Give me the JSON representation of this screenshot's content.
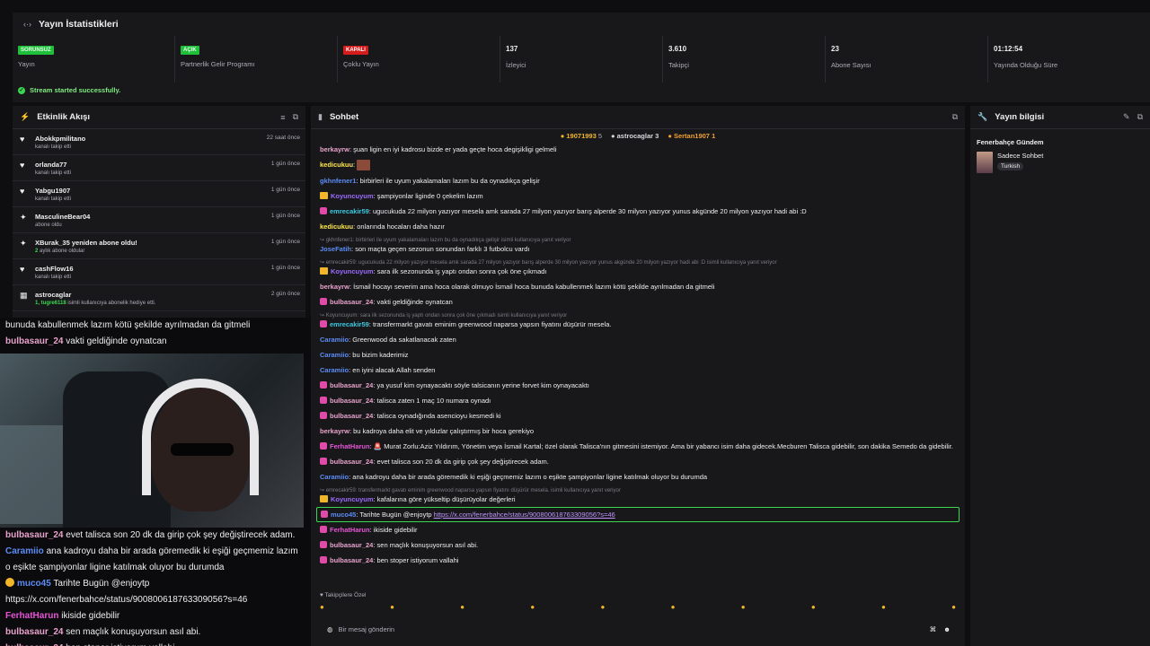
{
  "stats_panel": {
    "title": "Yayın İstatistikleri",
    "items": [
      {
        "badge": "SORUNSUZ",
        "badge_color": "green",
        "label": "Yayın"
      },
      {
        "badge": "AÇIK",
        "badge_color": "green",
        "label": "Partnerlik Gelir Programı"
      },
      {
        "badge": "KAPALI",
        "badge_color": "red",
        "label": "Çoklu Yayın"
      },
      {
        "value": "137",
        "label": "İzleyici"
      },
      {
        "value": "3.610",
        "label": "Takipçi"
      },
      {
        "value": "23",
        "label": "Abone Sayısı"
      },
      {
        "value": "01:12:54",
        "label": "Yayında Olduğu Süre"
      }
    ],
    "success_message": "Stream started successfully."
  },
  "activity": {
    "title": "Etkinlik Akışı",
    "items": [
      {
        "icon": "heart-icon",
        "glyph": "♥",
        "name": "Abokkpmilitano",
        "sub": "kanalı takip etti",
        "time": "22 saat önce"
      },
      {
        "icon": "heart-icon",
        "glyph": "♥",
        "name": "orlanda77",
        "sub": "kanalı takip etti",
        "time": "1 gün önce"
      },
      {
        "icon": "heart-icon",
        "glyph": "♥",
        "name": "Yabgu1907",
        "sub": "kanalı takip etti",
        "time": "1 gün önce"
      },
      {
        "icon": "star-icon",
        "glyph": "✦",
        "name": "MasculineBear04",
        "sub": "abone oldu",
        "time": "1 gün önce"
      },
      {
        "icon": "star-icon",
        "glyph": "✦",
        "name": "XBurak_35 yeniden abone oldu!",
        "sub_hl": "2",
        "sub": " aylık abone oldular",
        "time": "1 gün önce"
      },
      {
        "icon": "heart-icon",
        "glyph": "♥",
        "name": "cashFlow16",
        "sub": "kanalı takip etti",
        "time": "1 gün önce"
      },
      {
        "icon": "gift-icon",
        "glyph": "▦",
        "name": "astrocaglar",
        "sub_hl": "1, tugre6118",
        "sub": " isimli kullanıcıya abonelik hediye etti.",
        "time": "2 gün önce"
      }
    ]
  },
  "chat": {
    "title": "Sohbet",
    "pinned": [
      {
        "name": "19071993",
        "count": "5"
      },
      {
        "name": "astrocaglar",
        "count": "3"
      },
      {
        "name": "Sertan1907",
        "count": "1"
      }
    ],
    "messages": [
      {
        "user": "berkayrw",
        "color": "c-pink",
        "badge": "",
        "text": "şuan ligin en iyi kadrosu bizde er yada geçte hoca degişikligi gelmeli"
      },
      {
        "user": "kedicukuu",
        "color": "c-yellow",
        "badge": "",
        "text": "",
        "emote": true
      },
      {
        "user": "gkhnfener1",
        "color": "c-blue",
        "badge": "",
        "text": "birbirleri ile uyum yakalamaları lazım bu da oynadıkça gelişir"
      },
      {
        "user": "Koyuncuyum",
        "color": "c-purple",
        "badge": "crown",
        "text": "şampiyonlar liginde 0 çekelim lazım"
      },
      {
        "user": "emrecakir59",
        "color": "c-cyan",
        "badge": "sub",
        "text": "ugucukuda 22 milyon yazıyor mesela amk sarada 27 milyon yazıyor barış alperde 30 milyon yazıyor yunus akgünde 20 milyon yazıyor hadi abi :D"
      },
      {
        "user": "kedicukuu",
        "color": "c-yellow",
        "badge": "",
        "text": "onlarında hocaları daha hazır"
      },
      {
        "reply": "↪ gkhnfener1: birbirleri ile uyum yakalamaları lazım bu da oynadıkça gelişir isimli kullanıcıya yanıt veriyor",
        "user": "JoseFatih",
        "color": "c-blue",
        "badge": "",
        "text": "son maçta geçen sezonun sonundan farklı 3 futbolcu vardı"
      },
      {
        "reply": "↪ emrecakir59: ugucukuda 22 milyon yazıyor mesela amk sarada 27 milyon yazıyor barış alperde 30 milyon yazıyor yunus akgünde 20 milyon yazıyor hadi abi :D isimli kullanıcıya yanıt veriyor",
        "user": "Koyuncuyum",
        "color": "c-purple",
        "badge": "crown",
        "text": "sara ilk sezonunda iş yaptı ondan sonra çok öne çıkmadı"
      },
      {
        "user": "berkayrw",
        "color": "c-pink",
        "badge": "",
        "text": "İsmail hocayı severim ama hoca olarak olmuyo İsmail hoca bunuda kabullenmek lazım kötü şekilde ayrılmadan da gitmeli"
      },
      {
        "user": "bulbasaur_24",
        "color": "c-pink",
        "badge": "sub",
        "text": "vakti geldiğinde oynatcan"
      },
      {
        "reply": "↪ Koyuncuyum: sara ilk sezonunda iş yaptı ondan sonra çok öne çıkmadı isimli kullanıcıya yanıt veriyor",
        "user": "emrecakir59",
        "color": "c-cyan",
        "badge": "sub",
        "text": "transfermarkt gavatı eminim greenwood naparsa yapsın fiyatını düşürür mesela."
      },
      {
        "user": "Caramiio",
        "color": "c-blue",
        "badge": "",
        "text": "Greenwood da sakatlanacak zaten"
      },
      {
        "user": "Caramiio",
        "color": "c-blue",
        "badge": "",
        "text": "bu bizim kaderimiz"
      },
      {
        "user": "Caramiio",
        "color": "c-blue",
        "badge": "",
        "text": "en iyini alacak Allah senden"
      },
      {
        "user": "bulbasaur_24",
        "color": "c-pink",
        "badge": "sub",
        "text": "ya yusuf kim oynayacaktı söyle talsicanın yerine forvet kim oynayacaktı"
      },
      {
        "user": "bulbasaur_24",
        "color": "c-pink",
        "badge": "sub",
        "text": "talisca zaten 1 maç 10 numara oynadı"
      },
      {
        "user": "bulbasaur_24",
        "color": "c-pink",
        "badge": "sub",
        "text": "talisca oynadığında asencioyu kesmedi ki"
      },
      {
        "user": "berkayrw",
        "color": "c-pink",
        "badge": "",
        "text": "bu kadroya daha elit ve yıldızlar çalıştırmış bir hoca gerekiyo"
      },
      {
        "user": "FerhatHarun",
        "color": "c-magenta",
        "badge": "sub",
        "text": "🚨 Murat Zorlu:Aziz Yıldırım, Yönetim veya İsmail Kartal; özel olarak Talisca'nın gitmesini istemiyor. Ama bir yabancı isim daha gidecek.Mecburen Talisca gidebilir, son dakika Semedo da gidebilir."
      },
      {
        "user": "bulbasaur_24",
        "color": "c-pink",
        "badge": "sub",
        "text": "evet talisca son 20 dk da girip çok şey değiştirecek adam."
      },
      {
        "user": "Caramiio",
        "color": "c-blue",
        "badge": "",
        "text": "ana kadroyu daha bir arada göremedik ki eşiği geçmemiz lazım o eşikte şampiyonlar ligine katılmak oluyor bu durumda"
      },
      {
        "reply": "↪ emrecakir59: transfermarkt gavatı eminim greenwood naparsa yapsın fiyatını düşürür mesela. isimli kullanıcıya yanıt veriyor",
        "user": "Koyuncuyum",
        "color": "c-purple",
        "badge": "crown",
        "text": "kafalarına göre yükseltip düşürüyolar değerleri"
      },
      {
        "user": "muco45",
        "color": "c-blue",
        "badge": "sub",
        "text": "Tarihte Bugün @enjoytp ",
        "link": "https://x.com/fenerbahce/status/900800618763309056?s=46",
        "highlight": true
      },
      {
        "user": "FerhatHarun",
        "color": "c-magenta",
        "badge": "sub",
        "text": "ikiside gidebilir"
      },
      {
        "user": "bulbasaur_24",
        "color": "c-pink",
        "badge": "sub",
        "text": "sen maçlık konuşuyorsun asıl abi."
      },
      {
        "user": "bulbasaur_24",
        "color": "c-pink",
        "badge": "sub",
        "text": "ben stoper istiyorum vallahi"
      }
    ],
    "followers_only": "♥ Takipçilere Özel",
    "input_placeholder": "Bir mesaj gönderin"
  },
  "stream_info": {
    "title": "Yayın bilgisi",
    "category": "Fenerbahçe Gündem",
    "mode": "Sadece Sohbet",
    "tag": "Turkish"
  },
  "overlay": {
    "top_lines": [
      {
        "user": "",
        "text": "bunuda kabullenmek lazım kötü şekilde ayrılmadan da gitmeli"
      },
      {
        "user": "bulbasaur_24",
        "text": "vakti geldiğinde oynatcan"
      }
    ],
    "lower_lines": [
      {
        "user": "bulbasaur_24",
        "color": "#e8a3cc",
        "text": "evet talisca son 20 dk da girip çok şey değiştirecek adam."
      },
      {
        "user": "Caramiio",
        "color": "#5c8cf5",
        "text": "ana kadroyu daha bir arada göremedik ki eşiği geçmemiz lazım"
      },
      {
        "user": "",
        "color": "",
        "text": "o eşikte şampiyonlar ligine katılmak oluyor bu durumda"
      },
      {
        "user": "muco45",
        "color": "#5c8cf5",
        "text": "Tarihte Bugün @enjoytp",
        "dot": true
      },
      {
        "user": "",
        "color": "",
        "text": "https://x.com/fenerbahce/status/900800618763309056?s=46"
      },
      {
        "user": "FerhatHarun",
        "color": "#e854d8",
        "text": "ikiside gidebilir"
      },
      {
        "user": "bulbasaur_24",
        "color": "#e8a3cc",
        "text": "sen maçlık konuşuyorsun asıl abi."
      },
      {
        "user": "bulbasaur_24",
        "color": "#e8a3cc",
        "text": "ben stoper istiyorum vallahi"
      }
    ]
  }
}
